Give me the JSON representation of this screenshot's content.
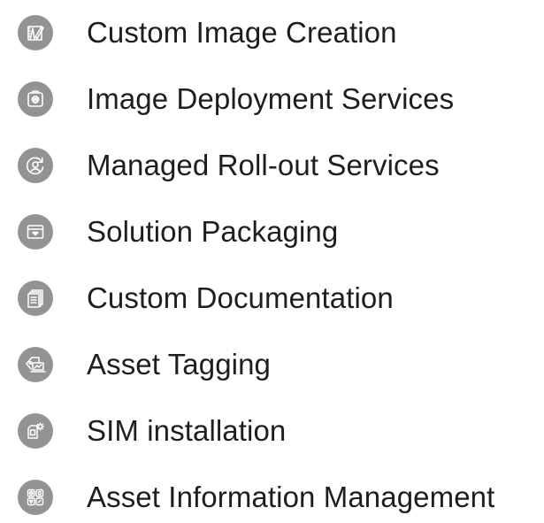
{
  "services": [
    {
      "label": "Custom Image Creation",
      "icon": "pencil-ruler-icon"
    },
    {
      "label": "Image Deployment Services",
      "icon": "camera-box-icon"
    },
    {
      "label": "Managed Roll-out Services",
      "icon": "refresh-globe-icon"
    },
    {
      "label": "Solution Packaging",
      "icon": "package-box-icon"
    },
    {
      "label": "Custom Documentation",
      "icon": "documents-icon"
    },
    {
      "label": "Asset Tagging",
      "icon": "tag-laptop-icon"
    },
    {
      "label": "SIM installation",
      "icon": "sim-gear-icon"
    },
    {
      "label": "Asset Information Management",
      "icon": "info-grid-icon"
    }
  ],
  "colors": {
    "icon_background": "#939393",
    "icon_stroke": "#ffffff",
    "text": "#1e1e1e"
  }
}
